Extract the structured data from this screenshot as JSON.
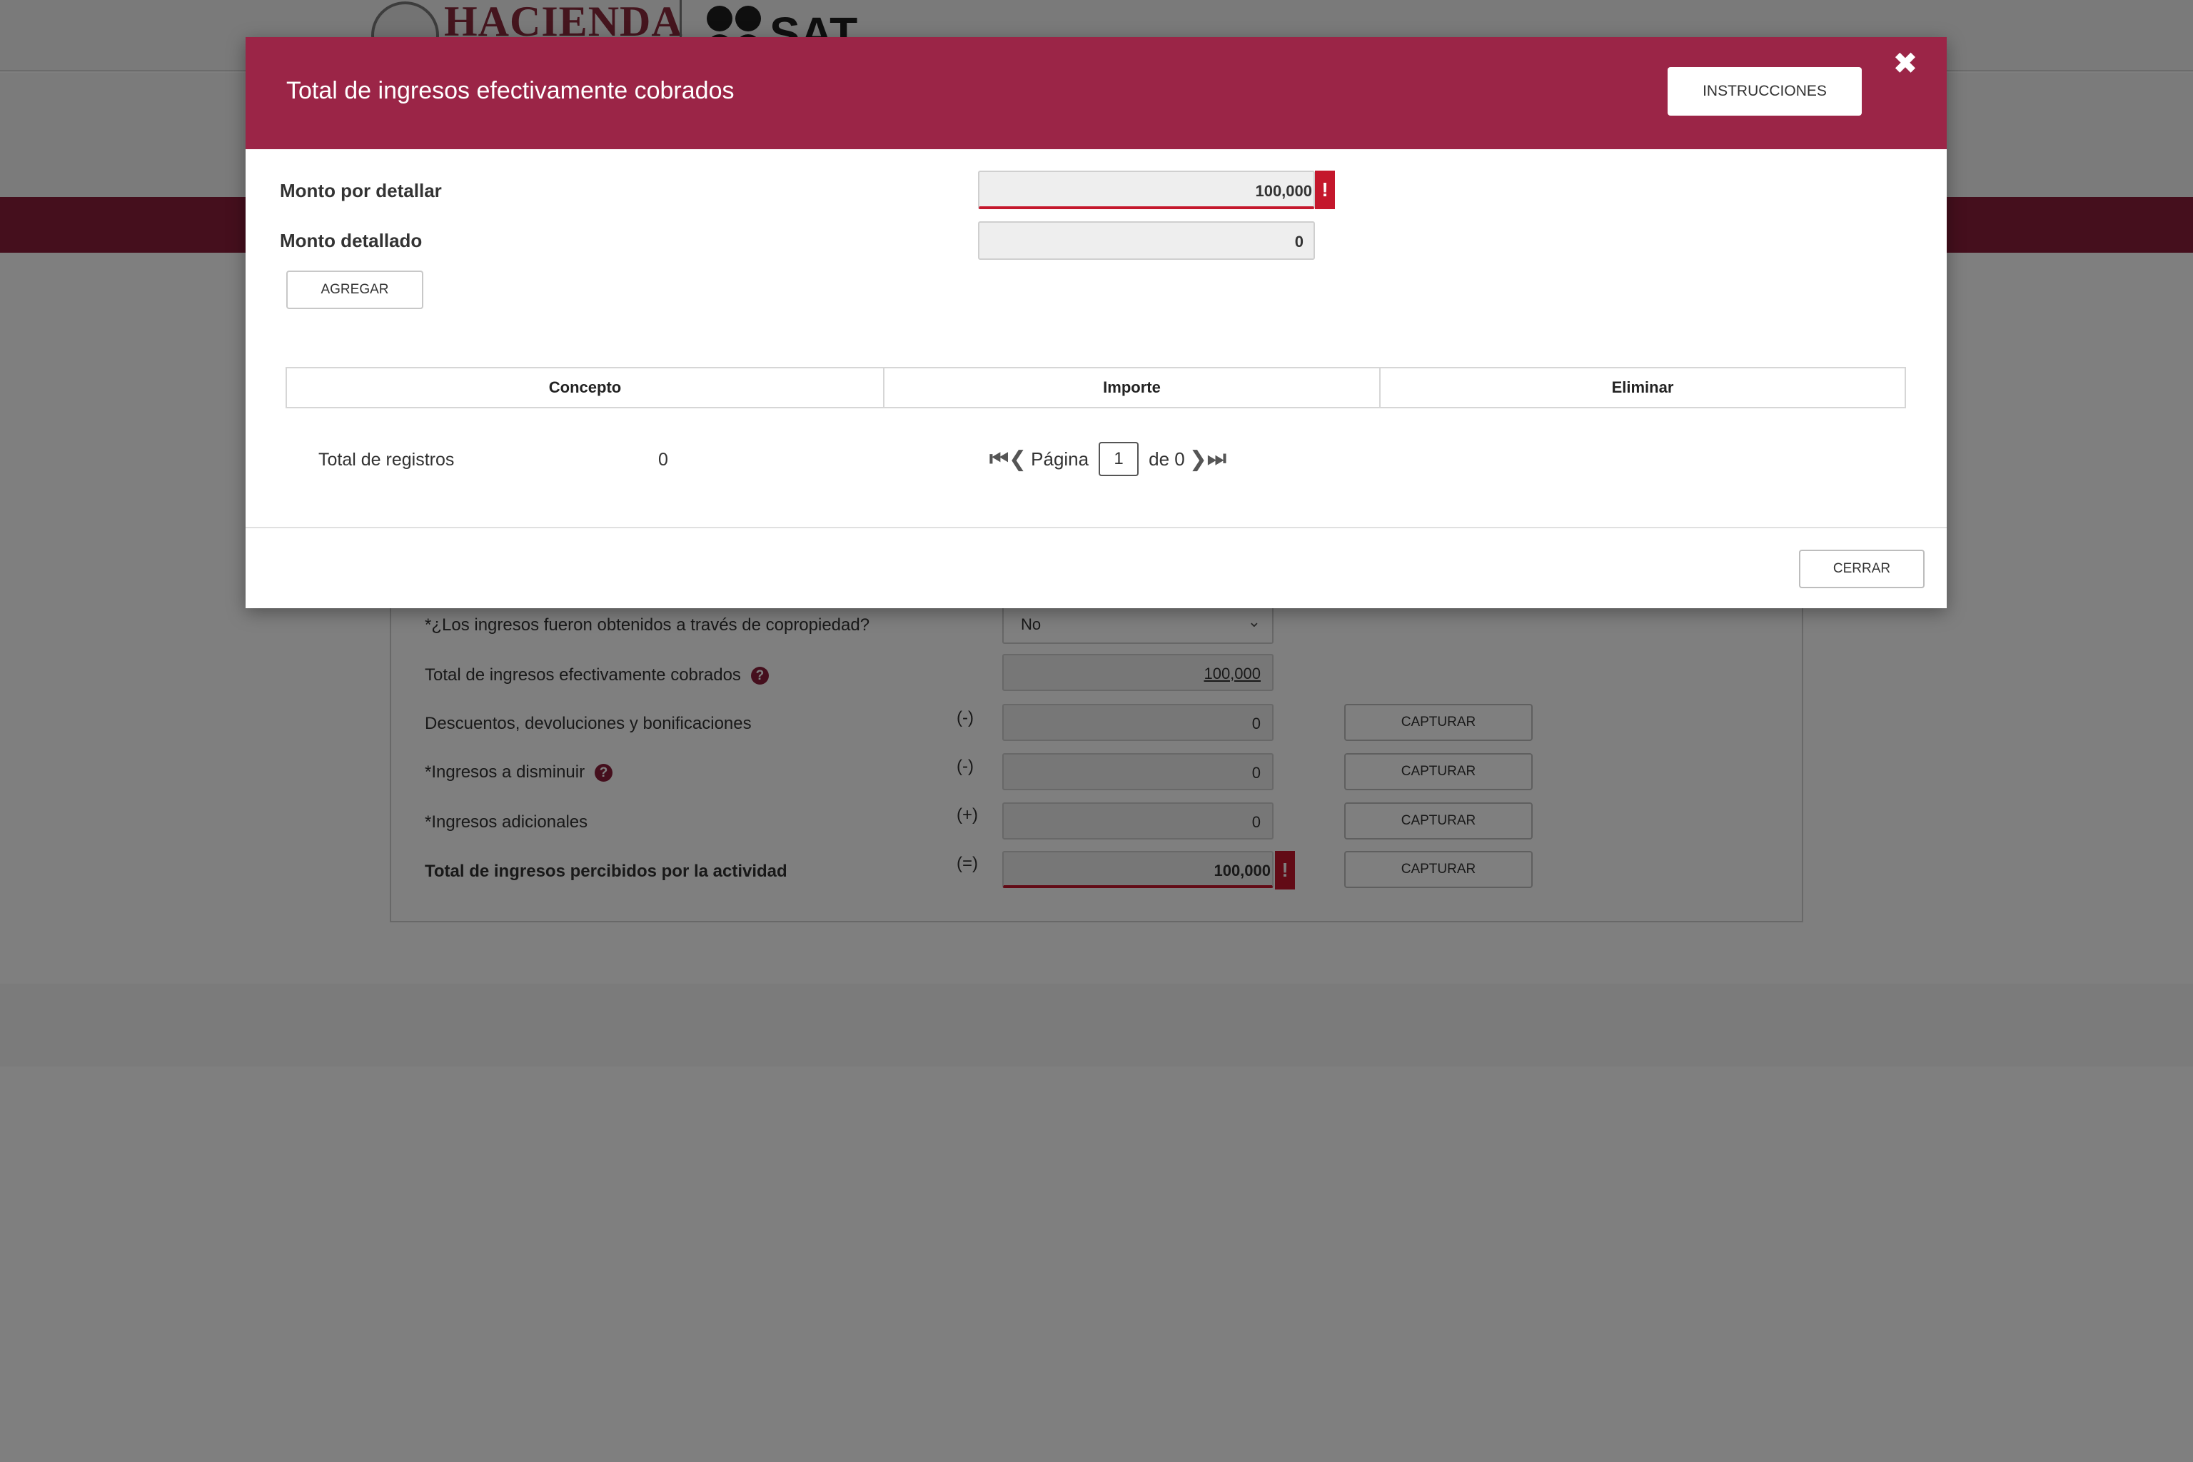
{
  "header": {
    "brand_hacienda": "HACIENDA",
    "brand_sat": "SAT"
  },
  "form": {
    "copropiedad_label": "*¿Los ingresos fueron obtenidos a través de copropiedad?",
    "copropiedad_value": "No",
    "total_cobrados_label": "Total de ingresos efectivamente cobrados",
    "total_cobrados_value": "100,000",
    "descuentos_label": "Descuentos, devoluciones y bonificaciones",
    "descuentos_sign": "(-)",
    "descuentos_value": "0",
    "disminuir_label": "*Ingresos a disminuir",
    "disminuir_sign": "(-)",
    "disminuir_value": "0",
    "adicionales_label": "*Ingresos adicionales",
    "adicionales_sign": "(+)",
    "adicionales_value": "0",
    "percibidos_label": "Total de ingresos percibidos por la actividad",
    "percibidos_sign": "(=)",
    "percibidos_value": "100,000",
    "capturar_label": "CAPTURAR",
    "help_glyph": "?",
    "error_glyph": "!",
    "select_chevron": "⌄"
  },
  "modal": {
    "title": "Total de ingresos efectivamente cobrados",
    "instrucciones_label": "INSTRUCCIONES",
    "close_glyph": "✖",
    "monto_por_detallar_label": "Monto por detallar",
    "monto_por_detallar_value": "100,000",
    "monto_detallado_label": "Monto detallado",
    "monto_detallado_value": "0",
    "agregar_label": "AGREGAR",
    "columns": [
      "Concepto",
      "Importe",
      "Eliminar"
    ],
    "total_registros_label": "Total de registros",
    "total_registros_value": "0",
    "pager": {
      "first_glyph": "⏮",
      "prev_glyph": "❮",
      "page_label": "Página",
      "current_page": "1",
      "of_label": "de 0",
      "next_glyph": "❯",
      "last_glyph": "⏭"
    },
    "cerrar_label": "CERRAR"
  },
  "colors": {
    "modal_header": "#9b2547",
    "brand_bar": "#8a1f3b",
    "error": "#c4172c",
    "overlay": "rgba(0,0,0,0.5)"
  }
}
